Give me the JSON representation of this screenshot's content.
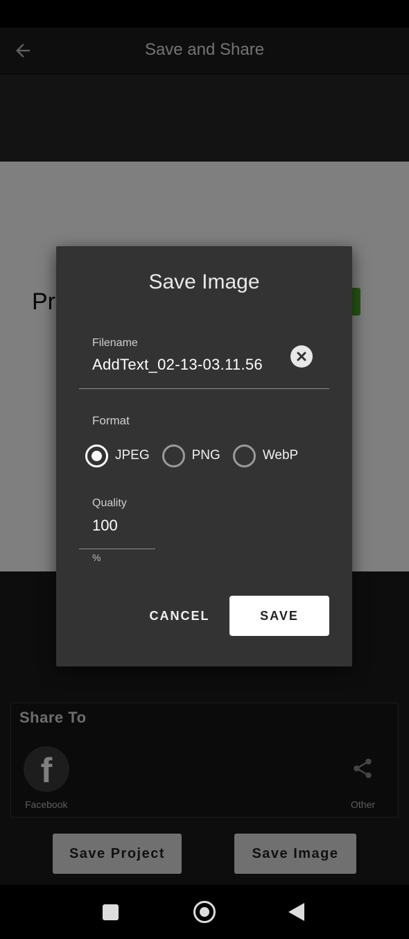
{
  "app_bar": {
    "title": "Save and Share",
    "back_icon": "arrow-left-icon"
  },
  "preview": {
    "visible_text": "Pr",
    "chip_color": "#4caf28"
  },
  "share": {
    "title": "Share To",
    "targets": [
      {
        "label": "Facebook",
        "icon": "facebook-icon",
        "glyph": "f"
      },
      {
        "label": "Other",
        "icon": "share-icon"
      }
    ]
  },
  "buttons": {
    "save_project": "Save Project",
    "save_image": "Save Image"
  },
  "dialog": {
    "title": "Save Image",
    "filename": {
      "label": "Filename",
      "value": "AddText_02-13-03.11.56",
      "clear_icon": "clear-icon"
    },
    "format": {
      "label": "Format",
      "options": [
        "JPEG",
        "PNG",
        "WebP"
      ],
      "selected": "JPEG"
    },
    "quality": {
      "label": "Quality",
      "value": "100",
      "suffix": "%"
    },
    "cancel_label": "CANCEL",
    "save_label": "SAVE"
  },
  "nav": {
    "recents_icon": "square-recents-icon",
    "home_icon": "circle-home-icon",
    "back_icon": "triangle-back-icon"
  }
}
